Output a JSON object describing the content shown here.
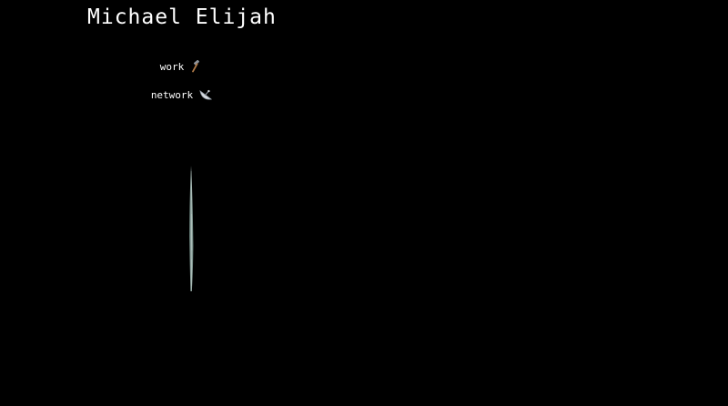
{
  "header": {
    "title": "Michael Elijah"
  },
  "nav": {
    "items": [
      {
        "label": "work",
        "icon": "hammer-icon"
      },
      {
        "label": "network",
        "icon": "satellite-dish-icon"
      }
    ]
  },
  "visual": {
    "object": "rotating-coin-edge",
    "colors": {
      "background": "#000000",
      "text": "#ffffff",
      "edge": "#7c9892"
    }
  }
}
